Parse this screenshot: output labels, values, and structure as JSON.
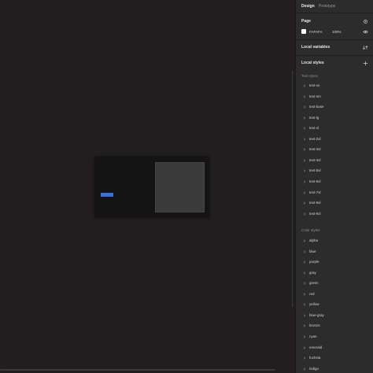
{
  "panel": {
    "tabs": [
      {
        "label": "Design",
        "active": true
      },
      {
        "label": "Prototype",
        "active": false
      }
    ],
    "page": {
      "title": "Page",
      "color_hex": "FAFAFA",
      "opacity": "100%",
      "swatch_color": "#fafafa"
    },
    "local_variables": {
      "title": "Local variables"
    },
    "local_styles": {
      "title": "Local styles",
      "text_styles_label": "Text styles",
      "text_styles": [
        "text-xs",
        "text-sm",
        "text-base",
        "text-lg",
        "text-xl",
        "text-2xl",
        "text-3xl",
        "text-4xl",
        "text-5xl",
        "text-6xl",
        "text-7xl",
        "text-8xl",
        "text-9xl"
      ],
      "color_styles_label": "Color styles",
      "color_styles": [
        "alpha",
        "blue",
        "purple",
        "gray",
        "green",
        "red",
        "yellow",
        "blue-gray",
        "bronze",
        "cyan",
        "emerald",
        "fuchsia",
        "indigo"
      ]
    }
  },
  "icons": {
    "settings": "settings-icon",
    "eye": "eye-icon",
    "variables": "variables-icon",
    "add": "plus-icon",
    "chevron": "chevron-right-icon"
  },
  "colors": {
    "canvas": "#221e1f",
    "panel": "#2c2c2c",
    "accent": "#3b6fe0"
  }
}
